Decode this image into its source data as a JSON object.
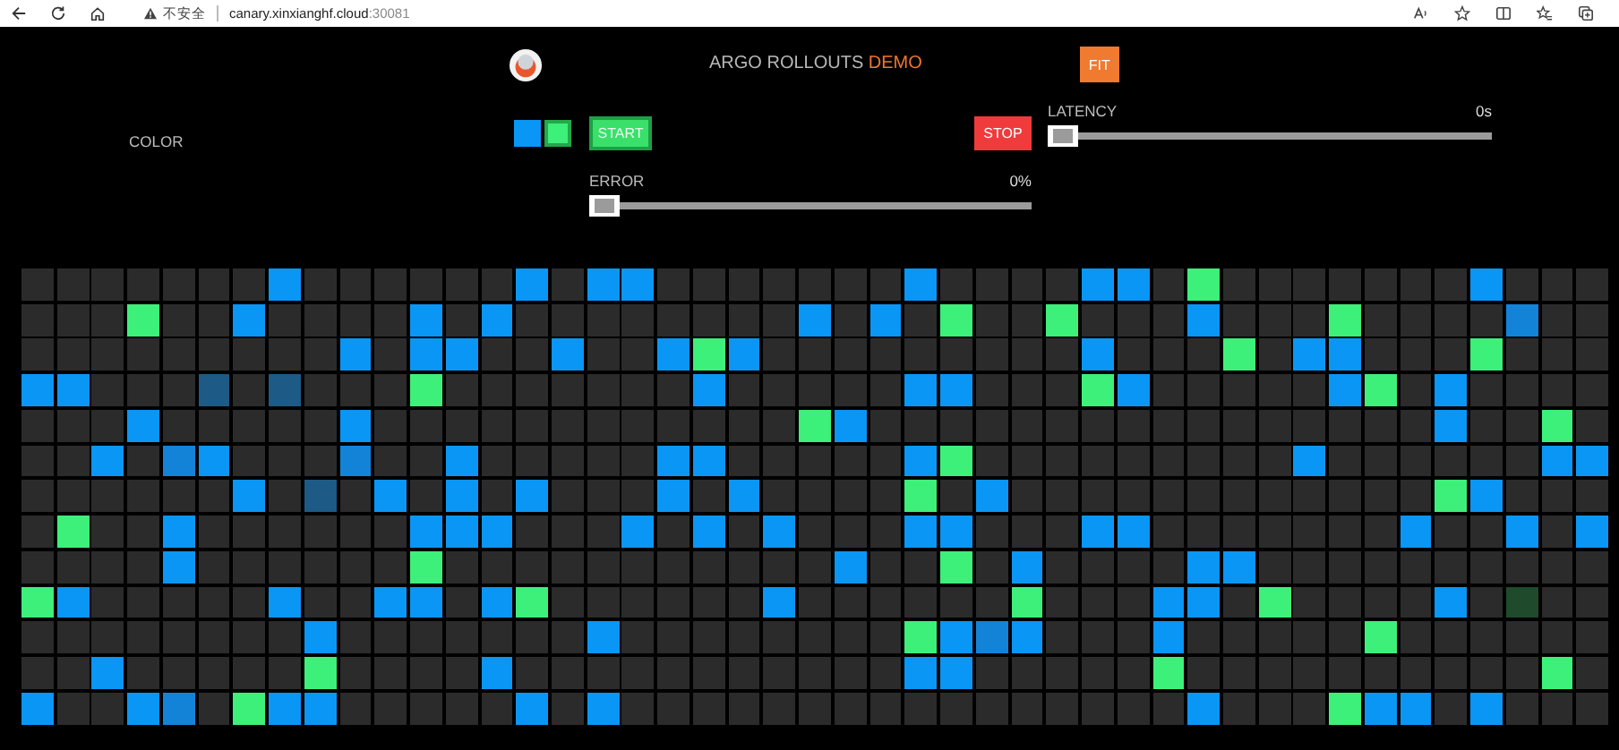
{
  "browser": {
    "security": "不安全",
    "url_host": "canary.xinxianghf.cloud",
    "url_port": ":30081"
  },
  "header": {
    "title": "ARGO ROLLOUTS",
    "accent": "DEMO",
    "fit_button": "FIT"
  },
  "color_picker": {
    "label": "COLOR",
    "swatches": [
      {
        "color": "#0a96f5",
        "selected": false
      },
      {
        "color": "#3df07a",
        "selected": true
      }
    ]
  },
  "buttons": {
    "start": "START",
    "stop": "STOP"
  },
  "sliders": [
    {
      "kind": "error",
      "label": "ERROR",
      "reading": "0%",
      "level": 0
    },
    {
      "kind": "latency",
      "label": "LATENCY",
      "reading": "0s",
      "level": 0
    }
  ],
  "grid": {
    "rows": [
      [
        {
          "color": "#2b2b2b"
        },
        {
          "color": "#2b2b2b"
        },
        {
          "color": "#2b2b2b"
        },
        {
          "color": "#2b2b2b"
        },
        {
          "color": "#2b2b2b"
        },
        {
          "color": "#2b2b2b"
        },
        {
          "color": "#2b2b2b"
        },
        {
          "color": "#0a96f5"
        },
        {
          "color": "#2b2b2b"
        },
        {
          "color": "#2b2b2b"
        },
        {
          "color": "#2b2b2b"
        },
        {
          "color": "#2b2b2b"
        },
        {
          "color": "#2b2b2b"
        },
        {
          "color": "#2b2b2b"
        },
        {
          "color": "#0a96f5"
        },
        {
          "color": "#2b2b2b"
        },
        {
          "color": "#0a96f5"
        },
        {
          "color": "#0a96f5"
        },
        {
          "color": "#2b2b2b"
        },
        {
          "color": "#2b2b2b"
        },
        {
          "color": "#2b2b2b"
        },
        {
          "color": "#2b2b2b"
        },
        {
          "color": "#2b2b2b"
        },
        {
          "color": "#2b2b2b"
        },
        {
          "color": "#2b2b2b"
        },
        {
          "color": "#0a96f5"
        },
        {
          "color": "#2b2b2b"
        },
        {
          "color": "#2b2b2b"
        },
        {
          "color": "#2b2b2b"
        },
        {
          "color": "#2b2b2b"
        },
        {
          "color": "#0a96f5"
        },
        {
          "color": "#0a96f5"
        },
        {
          "color": "#2b2b2b"
        },
        {
          "color": "#3df07a"
        },
        {
          "color": "#2b2b2b"
        },
        {
          "color": "#2b2b2b"
        },
        {
          "color": "#2b2b2b"
        },
        {
          "color": "#2b2b2b"
        },
        {
          "color": "#2b2b2b"
        },
        {
          "color": "#2b2b2b"
        },
        {
          "color": "#2b2b2b"
        },
        {
          "color": "#0a96f5"
        },
        {
          "color": "#2b2b2b"
        },
        {
          "color": "#2b2b2b"
        },
        {
          "color": "#2b2b2b"
        }
      ],
      [
        {
          "color": "#2b2b2b"
        },
        {
          "color": "#2b2b2b"
        },
        {
          "color": "#2b2b2b"
        },
        {
          "color": "#3df07a"
        },
        {
          "color": "#2b2b2b"
        },
        {
          "color": "#2b2b2b"
        },
        {
          "color": "#0a96f5"
        },
        {
          "color": "#2b2b2b"
        },
        {
          "color": "#2b2b2b"
        },
        {
          "color": "#2b2b2b"
        },
        {
          "color": "#2b2b2b"
        },
        {
          "color": "#0a96f5"
        },
        {
          "color": "#2b2b2b"
        },
        {
          "color": "#0a96f5"
        },
        {
          "color": "#2b2b2b"
        },
        {
          "color": "#2b2b2b"
        },
        {
          "color": "#2b2b2b"
        },
        {
          "color": "#2b2b2b"
        },
        {
          "color": "#2b2b2b"
        },
        {
          "color": "#2b2b2b"
        },
        {
          "color": "#2b2b2b"
        },
        {
          "color": "#2b2b2b"
        },
        {
          "color": "#0a96f5"
        },
        {
          "color": "#2b2b2b"
        },
        {
          "color": "#0a96f5"
        },
        {
          "color": "#2b2b2b"
        },
        {
          "color": "#3df07a"
        },
        {
          "color": "#2b2b2b"
        },
        {
          "color": "#2b2b2b"
        },
        {
          "color": "#3df07a"
        },
        {
          "color": "#2b2b2b"
        },
        {
          "color": "#2b2b2b"
        },
        {
          "color": "#2b2b2b"
        },
        {
          "color": "#0a96f5"
        },
        {
          "color": "#2b2b2b"
        },
        {
          "color": "#2b2b2b"
        },
        {
          "color": "#2b2b2b"
        },
        {
          "color": "#3df07a"
        },
        {
          "color": "#2b2b2b"
        },
        {
          "color": "#2b2b2b"
        },
        {
          "color": "#2b2b2b"
        },
        {
          "color": "#2b2b2b"
        },
        {
          "color": "#1383d8"
        },
        {
          "color": "#2b2b2b"
        },
        {
          "color": "#2b2b2b"
        }
      ],
      [
        {
          "color": "#2b2b2b"
        },
        {
          "color": "#2b2b2b"
        },
        {
          "color": "#2b2b2b"
        },
        {
          "color": "#2b2b2b"
        },
        {
          "color": "#2b2b2b"
        },
        {
          "color": "#2b2b2b"
        },
        {
          "color": "#2b2b2b"
        },
        {
          "color": "#2b2b2b"
        },
        {
          "color": "#2b2b2b"
        },
        {
          "color": "#0a96f5"
        },
        {
          "color": "#2b2b2b"
        },
        {
          "color": "#0a96f5"
        },
        {
          "color": "#0a96f5"
        },
        {
          "color": "#2b2b2b"
        },
        {
          "color": "#2b2b2b"
        },
        {
          "color": "#0a96f5"
        },
        {
          "color": "#2b2b2b"
        },
        {
          "color": "#2b2b2b"
        },
        {
          "color": "#0a96f5"
        },
        {
          "color": "#3df07a"
        },
        {
          "color": "#0a96f5"
        },
        {
          "color": "#2b2b2b"
        },
        {
          "color": "#2b2b2b"
        },
        {
          "color": "#2b2b2b"
        },
        {
          "color": "#2b2b2b"
        },
        {
          "color": "#2b2b2b"
        },
        {
          "color": "#2b2b2b"
        },
        {
          "color": "#2b2b2b"
        },
        {
          "color": "#2b2b2b"
        },
        {
          "color": "#2b2b2b"
        },
        {
          "color": "#0a96f5"
        },
        {
          "color": "#2b2b2b"
        },
        {
          "color": "#2b2b2b"
        },
        {
          "color": "#2b2b2b"
        },
        {
          "color": "#3df07a"
        },
        {
          "color": "#2b2b2b"
        },
        {
          "color": "#0a96f5"
        },
        {
          "color": "#0a96f5"
        },
        {
          "color": "#2b2b2b"
        },
        {
          "color": "#2b2b2b"
        },
        {
          "color": "#2b2b2b"
        },
        {
          "color": "#3df07a"
        },
        {
          "color": "#2b2b2b"
        },
        {
          "color": "#2b2b2b"
        },
        {
          "color": "#2b2b2b"
        }
      ],
      [
        {
          "color": "#0a96f5"
        },
        {
          "color": "#0a96f5"
        },
        {
          "color": "#2b2b2b"
        },
        {
          "color": "#2b2b2b"
        },
        {
          "color": "#2b2b2b"
        },
        {
          "color": "#1d5a85"
        },
        {
          "color": "#2b2b2b"
        },
        {
          "color": "#1d5a85"
        },
        {
          "color": "#2b2b2b"
        },
        {
          "color": "#2b2b2b"
        },
        {
          "color": "#2b2b2b"
        },
        {
          "color": "#3df07a"
        },
        {
          "color": "#2b2b2b"
        },
        {
          "color": "#2b2b2b"
        },
        {
          "color": "#2b2b2b"
        },
        {
          "color": "#2b2b2b"
        },
        {
          "color": "#2b2b2b"
        },
        {
          "color": "#2b2b2b"
        },
        {
          "color": "#2b2b2b"
        },
        {
          "color": "#0a96f5"
        },
        {
          "color": "#2b2b2b"
        },
        {
          "color": "#2b2b2b"
        },
        {
          "color": "#2b2b2b"
        },
        {
          "color": "#2b2b2b"
        },
        {
          "color": "#2b2b2b"
        },
        {
          "color": "#0a96f5"
        },
        {
          "color": "#0a96f5"
        },
        {
          "color": "#2b2b2b"
        },
        {
          "color": "#2b2b2b"
        },
        {
          "color": "#2b2b2b"
        },
        {
          "color": "#3df07a"
        },
        {
          "color": "#0a96f5"
        },
        {
          "color": "#2b2b2b"
        },
        {
          "color": "#2b2b2b"
        },
        {
          "color": "#2b2b2b"
        },
        {
          "color": "#2b2b2b"
        },
        {
          "color": "#2b2b2b"
        },
        {
          "color": "#0a96f5"
        },
        {
          "color": "#3df07a"
        },
        {
          "color": "#2b2b2b"
        },
        {
          "color": "#0a96f5"
        },
        {
          "color": "#2b2b2b"
        },
        {
          "color": "#2b2b2b"
        },
        {
          "color": "#2b2b2b"
        },
        {
          "color": "#2b2b2b"
        }
      ],
      [
        {
          "color": "#2b2b2b"
        },
        {
          "color": "#2b2b2b"
        },
        {
          "color": "#2b2b2b"
        },
        {
          "color": "#0a96f5"
        },
        {
          "color": "#2b2b2b"
        },
        {
          "color": "#2b2b2b"
        },
        {
          "color": "#2b2b2b"
        },
        {
          "color": "#2b2b2b"
        },
        {
          "color": "#2b2b2b"
        },
        {
          "color": "#0a96f5"
        },
        {
          "color": "#2b2b2b"
        },
        {
          "color": "#2b2b2b"
        },
        {
          "color": "#2b2b2b"
        },
        {
          "color": "#2b2b2b"
        },
        {
          "color": "#2b2b2b"
        },
        {
          "color": "#2b2b2b"
        },
        {
          "color": "#2b2b2b"
        },
        {
          "color": "#2b2b2b"
        },
        {
          "color": "#2b2b2b"
        },
        {
          "color": "#2b2b2b"
        },
        {
          "color": "#2b2b2b"
        },
        {
          "color": "#2b2b2b"
        },
        {
          "color": "#3df07a"
        },
        {
          "color": "#0a96f5"
        },
        {
          "color": "#2b2b2b"
        },
        {
          "color": "#2b2b2b"
        },
        {
          "color": "#2b2b2b"
        },
        {
          "color": "#2b2b2b"
        },
        {
          "color": "#2b2b2b"
        },
        {
          "color": "#2b2b2b"
        },
        {
          "color": "#2b2b2b"
        },
        {
          "color": "#2b2b2b"
        },
        {
          "color": "#2b2b2b"
        },
        {
          "color": "#2b2b2b"
        },
        {
          "color": "#2b2b2b"
        },
        {
          "color": "#2b2b2b"
        },
        {
          "color": "#2b2b2b"
        },
        {
          "color": "#2b2b2b"
        },
        {
          "color": "#2b2b2b"
        },
        {
          "color": "#2b2b2b"
        },
        {
          "color": "#0a96f5"
        },
        {
          "color": "#2b2b2b"
        },
        {
          "color": "#2b2b2b"
        },
        {
          "color": "#3df07a"
        },
        {
          "color": "#2b2b2b"
        }
      ],
      [
        {
          "color": "#2b2b2b"
        },
        {
          "color": "#2b2b2b"
        },
        {
          "color": "#0a96f5"
        },
        {
          "color": "#2b2b2b"
        },
        {
          "color": "#1383d8"
        },
        {
          "color": "#0a96f5"
        },
        {
          "color": "#2b2b2b"
        },
        {
          "color": "#2b2b2b"
        },
        {
          "color": "#2b2b2b"
        },
        {
          "color": "#1383d8"
        },
        {
          "color": "#2b2b2b"
        },
        {
          "color": "#2b2b2b"
        },
        {
          "color": "#0a96f5"
        },
        {
          "color": "#2b2b2b"
        },
        {
          "color": "#2b2b2b"
        },
        {
          "color": "#2b2b2b"
        },
        {
          "color": "#2b2b2b"
        },
        {
          "color": "#2b2b2b"
        },
        {
          "color": "#0a96f5"
        },
        {
          "color": "#0a96f5"
        },
        {
          "color": "#2b2b2b"
        },
        {
          "color": "#2b2b2b"
        },
        {
          "color": "#2b2b2b"
        },
        {
          "color": "#2b2b2b"
        },
        {
          "color": "#2b2b2b"
        },
        {
          "color": "#0a96f5"
        },
        {
          "color": "#3df07a"
        },
        {
          "color": "#2b2b2b"
        },
        {
          "color": "#2b2b2b"
        },
        {
          "color": "#2b2b2b"
        },
        {
          "color": "#2b2b2b"
        },
        {
          "color": "#2b2b2b"
        },
        {
          "color": "#2b2b2b"
        },
        {
          "color": "#2b2b2b"
        },
        {
          "color": "#2b2b2b"
        },
        {
          "color": "#2b2b2b"
        },
        {
          "color": "#0a96f5"
        },
        {
          "color": "#2b2b2b"
        },
        {
          "color": "#2b2b2b"
        },
        {
          "color": "#2b2b2b"
        },
        {
          "color": "#2b2b2b"
        },
        {
          "color": "#2b2b2b"
        },
        {
          "color": "#2b2b2b"
        },
        {
          "color": "#0a96f5"
        },
        {
          "color": "#0a96f5"
        }
      ],
      [
        {
          "color": "#2b2b2b"
        },
        {
          "color": "#2b2b2b"
        },
        {
          "color": "#2b2b2b"
        },
        {
          "color": "#2b2b2b"
        },
        {
          "color": "#2b2b2b"
        },
        {
          "color": "#2b2b2b"
        },
        {
          "color": "#0a96f5"
        },
        {
          "color": "#2b2b2b"
        },
        {
          "color": "#1d5a85"
        },
        {
          "color": "#2b2b2b"
        },
        {
          "color": "#0a96f5"
        },
        {
          "color": "#2b2b2b"
        },
        {
          "color": "#0a96f5"
        },
        {
          "color": "#2b2b2b"
        },
        {
          "color": "#0a96f5"
        },
        {
          "color": "#2b2b2b"
        },
        {
          "color": "#2b2b2b"
        },
        {
          "color": "#2b2b2b"
        },
        {
          "color": "#0a96f5"
        },
        {
          "color": "#2b2b2b"
        },
        {
          "color": "#0a96f5"
        },
        {
          "color": "#2b2b2b"
        },
        {
          "color": "#2b2b2b"
        },
        {
          "color": "#2b2b2b"
        },
        {
          "color": "#2b2b2b"
        },
        {
          "color": "#3df07a"
        },
        {
          "color": "#2b2b2b"
        },
        {
          "color": "#0a96f5"
        },
        {
          "color": "#2b2b2b"
        },
        {
          "color": "#2b2b2b"
        },
        {
          "color": "#2b2b2b"
        },
        {
          "color": "#2b2b2b"
        },
        {
          "color": "#2b2b2b"
        },
        {
          "color": "#2b2b2b"
        },
        {
          "color": "#2b2b2b"
        },
        {
          "color": "#2b2b2b"
        },
        {
          "color": "#2b2b2b"
        },
        {
          "color": "#2b2b2b"
        },
        {
          "color": "#2b2b2b"
        },
        {
          "color": "#2b2b2b"
        },
        {
          "color": "#3df07a"
        },
        {
          "color": "#0a96f5"
        },
        {
          "color": "#2b2b2b"
        },
        {
          "color": "#2b2b2b"
        },
        {
          "color": "#2b2b2b"
        }
      ],
      [
        {
          "color": "#2b2b2b"
        },
        {
          "color": "#3df07a"
        },
        {
          "color": "#2b2b2b"
        },
        {
          "color": "#2b2b2b"
        },
        {
          "color": "#0a96f5"
        },
        {
          "color": "#2b2b2b"
        },
        {
          "color": "#2b2b2b"
        },
        {
          "color": "#2b2b2b"
        },
        {
          "color": "#2b2b2b"
        },
        {
          "color": "#2b2b2b"
        },
        {
          "color": "#2b2b2b"
        },
        {
          "color": "#0a96f5"
        },
        {
          "color": "#0a96f5"
        },
        {
          "color": "#0a96f5"
        },
        {
          "color": "#2b2b2b"
        },
        {
          "color": "#2b2b2b"
        },
        {
          "color": "#2b2b2b"
        },
        {
          "color": "#0a96f5"
        },
        {
          "color": "#2b2b2b"
        },
        {
          "color": "#0a96f5"
        },
        {
          "color": "#2b2b2b"
        },
        {
          "color": "#0a96f5"
        },
        {
          "color": "#2b2b2b"
        },
        {
          "color": "#2b2b2b"
        },
        {
          "color": "#2b2b2b"
        },
        {
          "color": "#0a96f5"
        },
        {
          "color": "#0a96f5"
        },
        {
          "color": "#2b2b2b"
        },
        {
          "color": "#2b2b2b"
        },
        {
          "color": "#2b2b2b"
        },
        {
          "color": "#0a96f5"
        },
        {
          "color": "#0a96f5"
        },
        {
          "color": "#2b2b2b"
        },
        {
          "color": "#2b2b2b"
        },
        {
          "color": "#2b2b2b"
        },
        {
          "color": "#2b2b2b"
        },
        {
          "color": "#2b2b2b"
        },
        {
          "color": "#2b2b2b"
        },
        {
          "color": "#2b2b2b"
        },
        {
          "color": "#0a96f5"
        },
        {
          "color": "#2b2b2b"
        },
        {
          "color": "#2b2b2b"
        },
        {
          "color": "#0a96f5"
        },
        {
          "color": "#2b2b2b"
        },
        {
          "color": "#0a96f5"
        }
      ],
      [
        {
          "color": "#2b2b2b"
        },
        {
          "color": "#2b2b2b"
        },
        {
          "color": "#2b2b2b"
        },
        {
          "color": "#2b2b2b"
        },
        {
          "color": "#0a96f5"
        },
        {
          "color": "#2b2b2b"
        },
        {
          "color": "#2b2b2b"
        },
        {
          "color": "#2b2b2b"
        },
        {
          "color": "#2b2b2b"
        },
        {
          "color": "#2b2b2b"
        },
        {
          "color": "#2b2b2b"
        },
        {
          "color": "#3df07a"
        },
        {
          "color": "#2b2b2b"
        },
        {
          "color": "#2b2b2b"
        },
        {
          "color": "#2b2b2b"
        },
        {
          "color": "#2b2b2b"
        },
        {
          "color": "#2b2b2b"
        },
        {
          "color": "#2b2b2b"
        },
        {
          "color": "#2b2b2b"
        },
        {
          "color": "#2b2b2b"
        },
        {
          "color": "#2b2b2b"
        },
        {
          "color": "#2b2b2b"
        },
        {
          "color": "#2b2b2b"
        },
        {
          "color": "#0a96f5"
        },
        {
          "color": "#2b2b2b"
        },
        {
          "color": "#2b2b2b"
        },
        {
          "color": "#3df07a"
        },
        {
          "color": "#2b2b2b"
        },
        {
          "color": "#0a96f5"
        },
        {
          "color": "#2b2b2b"
        },
        {
          "color": "#2b2b2b"
        },
        {
          "color": "#2b2b2b"
        },
        {
          "color": "#2b2b2b"
        },
        {
          "color": "#0a96f5"
        },
        {
          "color": "#0a96f5"
        },
        {
          "color": "#2b2b2b"
        },
        {
          "color": "#2b2b2b"
        },
        {
          "color": "#2b2b2b"
        },
        {
          "color": "#2b2b2b"
        },
        {
          "color": "#2b2b2b"
        },
        {
          "color": "#2b2b2b"
        },
        {
          "color": "#2b2b2b"
        },
        {
          "color": "#2b2b2b"
        },
        {
          "color": "#2b2b2b"
        },
        {
          "color": "#2b2b2b"
        }
      ],
      [
        {
          "color": "#3df07a"
        },
        {
          "color": "#0a96f5"
        },
        {
          "color": "#2b2b2b"
        },
        {
          "color": "#2b2b2b"
        },
        {
          "color": "#2b2b2b"
        },
        {
          "color": "#2b2b2b"
        },
        {
          "color": "#2b2b2b"
        },
        {
          "color": "#0a96f5"
        },
        {
          "color": "#2b2b2b"
        },
        {
          "color": "#2b2b2b"
        },
        {
          "color": "#0a96f5"
        },
        {
          "color": "#0a96f5"
        },
        {
          "color": "#2b2b2b"
        },
        {
          "color": "#0a96f5"
        },
        {
          "color": "#3df07a"
        },
        {
          "color": "#2b2b2b"
        },
        {
          "color": "#2b2b2b"
        },
        {
          "color": "#2b2b2b"
        },
        {
          "color": "#2b2b2b"
        },
        {
          "color": "#2b2b2b"
        },
        {
          "color": "#2b2b2b"
        },
        {
          "color": "#0a96f5"
        },
        {
          "color": "#2b2b2b"
        },
        {
          "color": "#2b2b2b"
        },
        {
          "color": "#2b2b2b"
        },
        {
          "color": "#2b2b2b"
        },
        {
          "color": "#2b2b2b"
        },
        {
          "color": "#2b2b2b"
        },
        {
          "color": "#3df07a"
        },
        {
          "color": "#2b2b2b"
        },
        {
          "color": "#2b2b2b"
        },
        {
          "color": "#2b2b2b"
        },
        {
          "color": "#0a96f5"
        },
        {
          "color": "#0a96f5"
        },
        {
          "color": "#2b2b2b"
        },
        {
          "color": "#3df07a"
        },
        {
          "color": "#2b2b2b"
        },
        {
          "color": "#2b2b2b"
        },
        {
          "color": "#2b2b2b"
        },
        {
          "color": "#2b2b2b"
        },
        {
          "color": "#0a96f5"
        },
        {
          "color": "#2b2b2b"
        },
        {
          "color": "#1f4a2c"
        },
        {
          "color": "#2b2b2b"
        },
        {
          "color": "#2b2b2b"
        }
      ],
      [
        {
          "color": "#2b2b2b"
        },
        {
          "color": "#2b2b2b"
        },
        {
          "color": "#2b2b2b"
        },
        {
          "color": "#2b2b2b"
        },
        {
          "color": "#2b2b2b"
        },
        {
          "color": "#2b2b2b"
        },
        {
          "color": "#2b2b2b"
        },
        {
          "color": "#2b2b2b"
        },
        {
          "color": "#0a96f5"
        },
        {
          "color": "#2b2b2b"
        },
        {
          "color": "#2b2b2b"
        },
        {
          "color": "#2b2b2b"
        },
        {
          "color": "#2b2b2b"
        },
        {
          "color": "#2b2b2b"
        },
        {
          "color": "#2b2b2b"
        },
        {
          "color": "#2b2b2b"
        },
        {
          "color": "#0a96f5"
        },
        {
          "color": "#2b2b2b"
        },
        {
          "color": "#2b2b2b"
        },
        {
          "color": "#2b2b2b"
        },
        {
          "color": "#2b2b2b"
        },
        {
          "color": "#2b2b2b"
        },
        {
          "color": "#2b2b2b"
        },
        {
          "color": "#2b2b2b"
        },
        {
          "color": "#2b2b2b"
        },
        {
          "color": "#3df07a"
        },
        {
          "color": "#0a96f5"
        },
        {
          "color": "#1383d8"
        },
        {
          "color": "#0a96f5"
        },
        {
          "color": "#2b2b2b"
        },
        {
          "color": "#2b2b2b"
        },
        {
          "color": "#2b2b2b"
        },
        {
          "color": "#0a96f5"
        },
        {
          "color": "#2b2b2b"
        },
        {
          "color": "#2b2b2b"
        },
        {
          "color": "#2b2b2b"
        },
        {
          "color": "#2b2b2b"
        },
        {
          "color": "#2b2b2b"
        },
        {
          "color": "#3df07a"
        },
        {
          "color": "#2b2b2b"
        },
        {
          "color": "#2b2b2b"
        },
        {
          "color": "#2b2b2b"
        },
        {
          "color": "#2b2b2b"
        },
        {
          "color": "#2b2b2b"
        },
        {
          "color": "#2b2b2b"
        }
      ],
      [
        {
          "color": "#2b2b2b"
        },
        {
          "color": "#2b2b2b"
        },
        {
          "color": "#0a96f5"
        },
        {
          "color": "#2b2b2b"
        },
        {
          "color": "#2b2b2b"
        },
        {
          "color": "#2b2b2b"
        },
        {
          "color": "#2b2b2b"
        },
        {
          "color": "#2b2b2b"
        },
        {
          "color": "#3df07a"
        },
        {
          "color": "#2b2b2b"
        },
        {
          "color": "#2b2b2b"
        },
        {
          "color": "#2b2b2b"
        },
        {
          "color": "#2b2b2b"
        },
        {
          "color": "#0a96f5"
        },
        {
          "color": "#2b2b2b"
        },
        {
          "color": "#2b2b2b"
        },
        {
          "color": "#2b2b2b"
        },
        {
          "color": "#2b2b2b"
        },
        {
          "color": "#2b2b2b"
        },
        {
          "color": "#2b2b2b"
        },
        {
          "color": "#2b2b2b"
        },
        {
          "color": "#2b2b2b"
        },
        {
          "color": "#2b2b2b"
        },
        {
          "color": "#2b2b2b"
        },
        {
          "color": "#2b2b2b"
        },
        {
          "color": "#0a96f5"
        },
        {
          "color": "#0a96f5"
        },
        {
          "color": "#2b2b2b"
        },
        {
          "color": "#2b2b2b"
        },
        {
          "color": "#2b2b2b"
        },
        {
          "color": "#2b2b2b"
        },
        {
          "color": "#2b2b2b"
        },
        {
          "color": "#3df07a"
        },
        {
          "color": "#2b2b2b"
        },
        {
          "color": "#2b2b2b"
        },
        {
          "color": "#2b2b2b"
        },
        {
          "color": "#2b2b2b"
        },
        {
          "color": "#2b2b2b"
        },
        {
          "color": "#2b2b2b"
        },
        {
          "color": "#2b2b2b"
        },
        {
          "color": "#2b2b2b"
        },
        {
          "color": "#2b2b2b"
        },
        {
          "color": "#2b2b2b"
        },
        {
          "color": "#3df07a"
        },
        {
          "color": "#2b2b2b"
        }
      ],
      [
        {
          "color": "#0a96f5"
        },
        {
          "color": "#2b2b2b"
        },
        {
          "color": "#2b2b2b"
        },
        {
          "color": "#0a96f5"
        },
        {
          "color": "#1383d8"
        },
        {
          "color": "#2b2b2b"
        },
        {
          "color": "#3df07a"
        },
        {
          "color": "#0a96f5"
        },
        {
          "color": "#0a96f5"
        },
        {
          "color": "#2b2b2b"
        },
        {
          "color": "#2b2b2b"
        },
        {
          "color": "#2b2b2b"
        },
        {
          "color": "#2b2b2b"
        },
        {
          "color": "#2b2b2b"
        },
        {
          "color": "#0a96f5"
        },
        {
          "color": "#2b2b2b"
        },
        {
          "color": "#0a96f5"
        },
        {
          "color": "#2b2b2b"
        },
        {
          "color": "#2b2b2b"
        },
        {
          "color": "#2b2b2b"
        },
        {
          "color": "#2b2b2b"
        },
        {
          "color": "#2b2b2b"
        },
        {
          "color": "#2b2b2b"
        },
        {
          "color": "#2b2b2b"
        },
        {
          "color": "#2b2b2b"
        },
        {
          "color": "#2b2b2b"
        },
        {
          "color": "#2b2b2b"
        },
        {
          "color": "#2b2b2b"
        },
        {
          "color": "#2b2b2b"
        },
        {
          "color": "#2b2b2b"
        },
        {
          "color": "#2b2b2b"
        },
        {
          "color": "#2b2b2b"
        },
        {
          "color": "#2b2b2b"
        },
        {
          "color": "#0a96f5"
        },
        {
          "color": "#2b2b2b"
        },
        {
          "color": "#2b2b2b"
        },
        {
          "color": "#2b2b2b"
        },
        {
          "color": "#3df07a"
        },
        {
          "color": "#0a96f5"
        },
        {
          "color": "#0a96f5"
        },
        {
          "color": "#2b2b2b"
        },
        {
          "color": "#0a96f5"
        },
        {
          "color": "#2b2b2b"
        },
        {
          "color": "#2b2b2b"
        },
        {
          "color": "#2b2b2b"
        }
      ]
    ]
  }
}
